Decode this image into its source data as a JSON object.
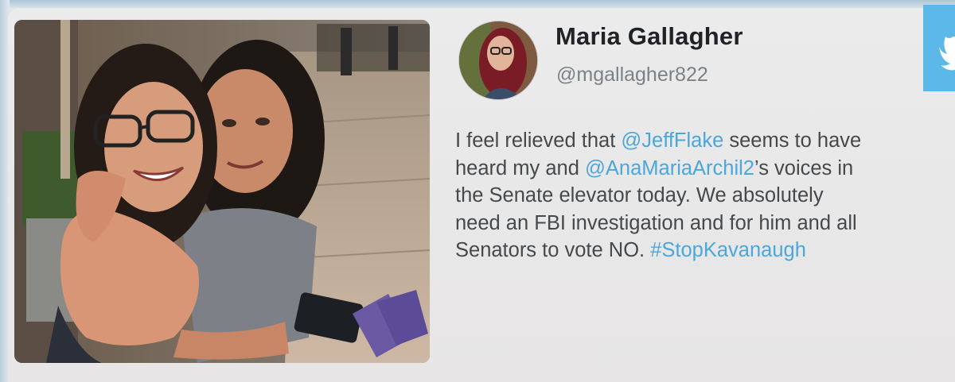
{
  "tweet": {
    "display_name": "Maria Gallagher",
    "handle": "@mgallagher822",
    "lines": [
      {
        "segments": [
          {
            "text": "I feel relieved that ",
            "link": false
          },
          {
            "text": "@JeffFlake",
            "link": true
          },
          {
            "text": " seems to have",
            "link": false
          }
        ]
      },
      {
        "segments": [
          {
            "text": "heard my and ",
            "link": false
          },
          {
            "text": "@AnaMariaArchil2",
            "link": true
          },
          {
            "text": "’s voices in",
            "link": false
          }
        ]
      },
      {
        "segments": [
          {
            "text": "the Senate elevator today. We absolutely",
            "link": false
          }
        ]
      },
      {
        "segments": [
          {
            "text": "need an FBI investigation and for him and all",
            "link": false
          }
        ]
      },
      {
        "segments": [
          {
            "text": "Senators to vote NO. ",
            "link": false
          },
          {
            "text": "#StopKavanaugh",
            "link": true
          }
        ]
      }
    ],
    "photo_icon": "photo-two-women-hugging",
    "avatar_icon": "profile-avatar",
    "brand_icon": "twitter-bird-icon",
    "colors": {
      "link": "#4ba7da",
      "text": "#45494c",
      "name": "#202326",
      "handle": "#7b8287",
      "twitter_blue": "#5cb8e8"
    }
  }
}
